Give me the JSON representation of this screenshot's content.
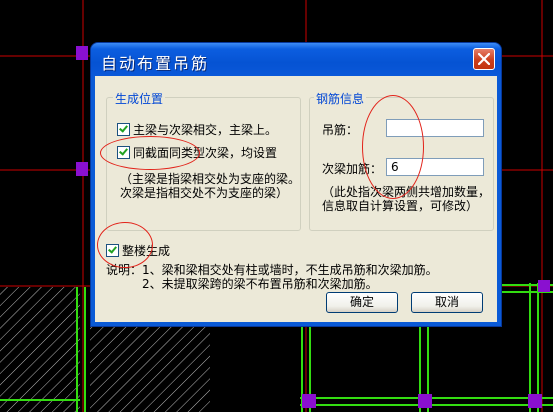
{
  "dialog": {
    "title": "自动布置吊筋",
    "close_icon": "close-icon"
  },
  "generate_position": {
    "legend": "生成位置",
    "option1": "主梁与次梁相交，主梁上。",
    "option2": "同截面同类型次梁，均设置",
    "note_line1": "（主梁是指梁相交处为支座的梁。",
    "note_line2": "次梁是指相交处不为支座的梁）"
  },
  "rebar_info": {
    "legend": "钢筋信息",
    "hanger_label": "吊筋：",
    "hanger_value": "",
    "secondary_label": "次梁加筋：",
    "secondary_value": "6",
    "note_line1": "（此处指次梁两侧共增加数量，",
    "note_line2": "信息取自计算设置，可修改）"
  },
  "whole_floor": {
    "label": "整楼生成"
  },
  "instructions": {
    "line1": "说明：1、梁和梁相交处有柱或墙时，不生成吊筋和次梁加筋。",
    "line2": "2、未提取梁跨的梁不布置吊筋和次梁加筋。"
  },
  "buttons": {
    "ok": "确定",
    "cancel": "取消"
  },
  "colors": {
    "title_bar": "#0a58d9",
    "dialog_bg": "#ece9d8",
    "group_legend": "#0046d5",
    "annotation": "#e2231a",
    "cad_beam": "#33dd11",
    "cad_node": "#8a10d0",
    "cad_axis": "#cc0000"
  }
}
